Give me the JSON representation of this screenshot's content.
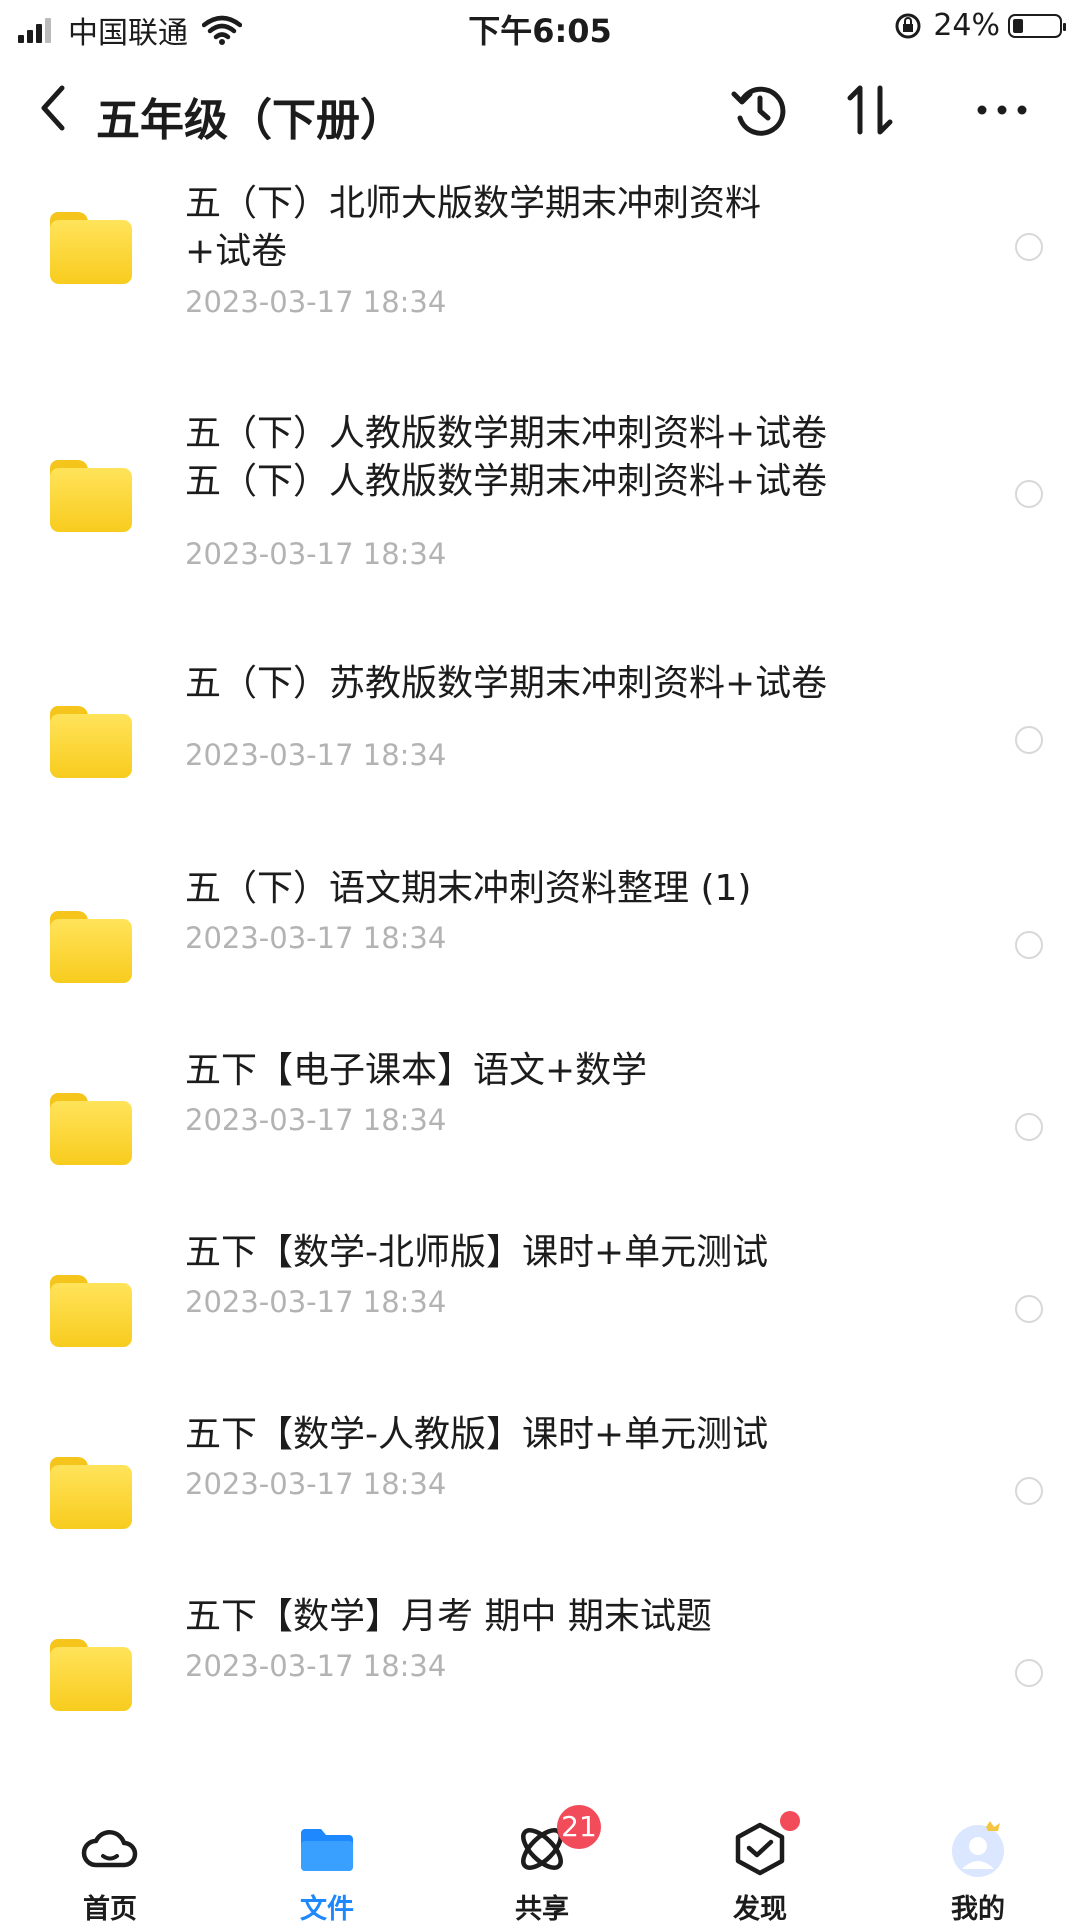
{
  "status_bar": {
    "carrier": "中国联通",
    "time": "下午6:05",
    "battery_percent": "24%"
  },
  "nav": {
    "title": "五年级（下册）",
    "icons": [
      "back-icon",
      "history-icon",
      "sort-icon",
      "more-icon"
    ]
  },
  "files": [
    {
      "name": "五（下）北师大版数学期末冲刺资料\n+试卷",
      "date": "2023-03-17 18:34"
    },
    {
      "name": "五（下）人教版数学期末冲刺资料+试卷\n五（下）人教版数学期末冲刺资料+试卷",
      "date": "2023-03-17 18:34"
    },
    {
      "name": "五（下）苏教版数学期末冲刺资料+试卷",
      "date": "2023-03-17 18:34"
    },
    {
      "name": "五（下）语文期末冲刺资料整理 (1)",
      "date": "2023-03-17 18:34"
    },
    {
      "name": "五下【电子课本】语文+数学",
      "date": "2023-03-17 18:34"
    },
    {
      "name": "五下【数学-北师版】课时+单元测试",
      "date": "2023-03-17 18:34"
    },
    {
      "name": "五下【数学-人教版】课时+单元测试",
      "date": "2023-03-17 18:34"
    },
    {
      "name": "五下【数学】月考 期中 期末试题",
      "date": "2023-03-17 18:34"
    }
  ],
  "tabbar": {
    "items": [
      {
        "label": "首页",
        "icon": "cloud-icon"
      },
      {
        "label": "文件",
        "icon": "folder-icon",
        "active": true
      },
      {
        "label": "共享",
        "icon": "share-icon",
        "badge": "21"
      },
      {
        "label": "发现",
        "icon": "discover-icon",
        "dot": true
      },
      {
        "label": "我的",
        "icon": "avatar-icon"
      }
    ]
  },
  "colors": {
    "accent": "#1e88ff",
    "folder": "#f8cc1e",
    "badge": "#f24b5a",
    "date_text": "#b3b3b3"
  }
}
